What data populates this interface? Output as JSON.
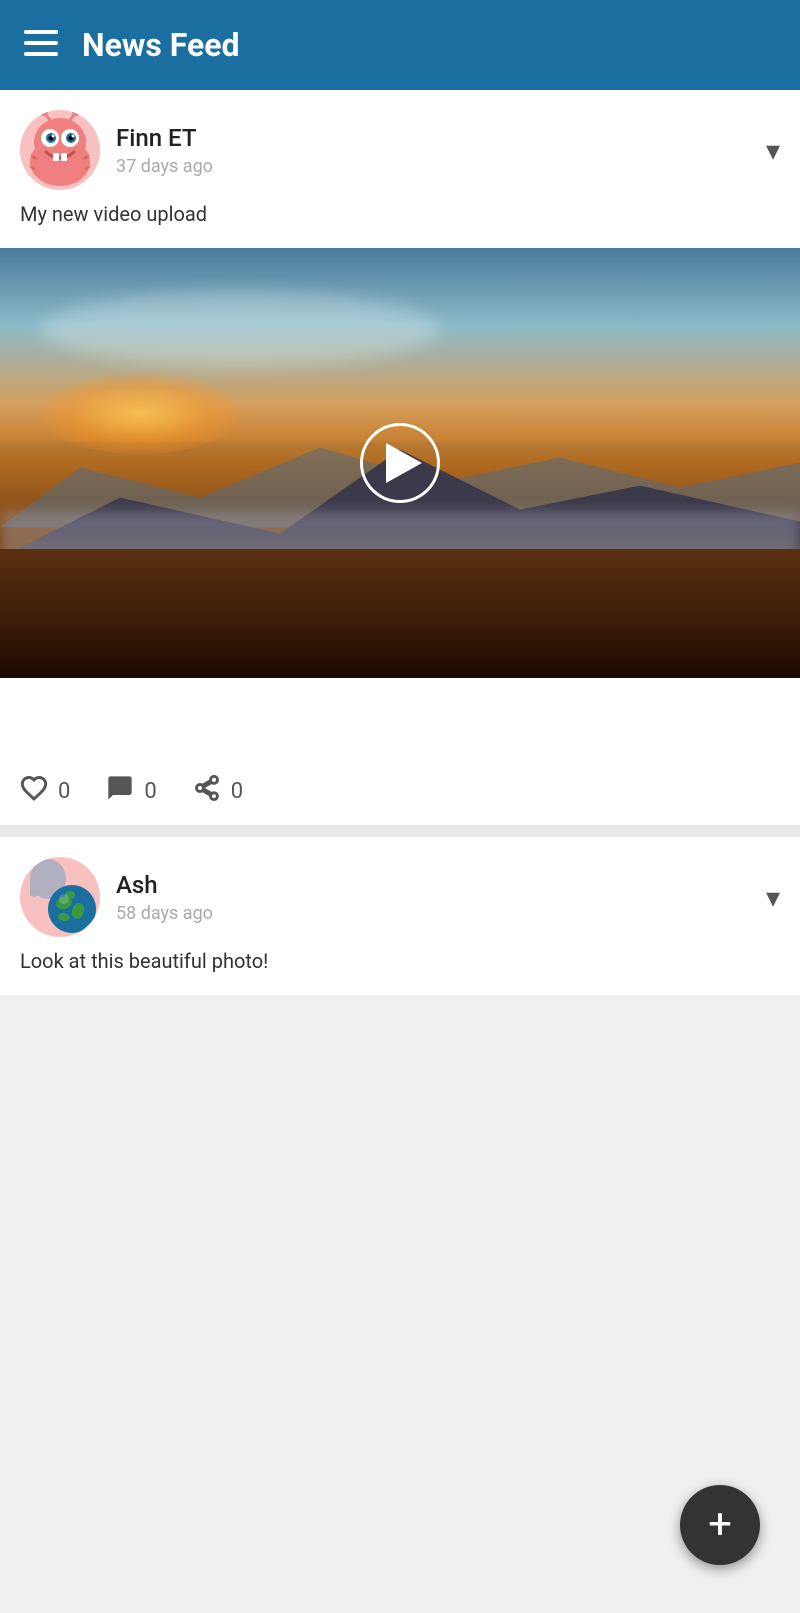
{
  "header": {
    "title": "News Feed",
    "hamburger_label": "☰"
  },
  "post1": {
    "username": "Finn ET",
    "time": "37 days ago",
    "text": "My new video upload",
    "likes": "0",
    "comments": "0",
    "shares": "0"
  },
  "post2": {
    "username": "Ash",
    "time": "58 days ago",
    "text": "Look at this beautiful photo!"
  },
  "fab": {
    "label": "+"
  }
}
